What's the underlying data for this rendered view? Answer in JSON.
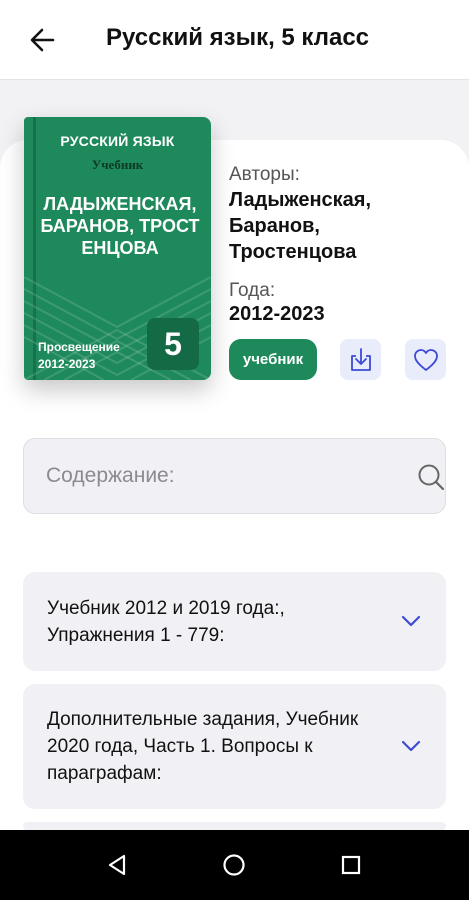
{
  "header": {
    "title": "Русский язык, 5 класс",
    "back_icon": "arrow-left-icon"
  },
  "book_cover": {
    "subject": "РУССКИЙ ЯЗЫК",
    "kind": "Учебник",
    "authors": "ЛАДЫЖЕНСКАЯ, БАРАНОВ, ТРОСТЕНЦОВА",
    "publisher": "Просвещение",
    "years": "2012-2023",
    "grade": "5",
    "color": "#1e8a5b"
  },
  "details": {
    "authors_label": "Авторы:",
    "authors_value": "Ладыженская, Баранов, Тростенцова",
    "years_label": "Года:",
    "years_value": "2012-2023",
    "type_button": "учебник",
    "download_icon": "download-icon",
    "favorite_icon": "heart-icon"
  },
  "search": {
    "placeholder": "Содержание:",
    "icon": "search-icon"
  },
  "sections": [
    {
      "title": "Учебник 2012 и 2019 года:, Упражнения 1 - 779:",
      "icon": "chevron-down-icon"
    },
    {
      "title": "Дополнительные задания, Учебник 2020 года, Часть 1. Вопросы к параграфам:",
      "icon": "chevron-down-icon"
    }
  ],
  "nav": {
    "back": "nav-back-icon",
    "home": "nav-home-icon",
    "recents": "nav-recents-icon"
  },
  "colors": {
    "accent_green": "#1e8a5b",
    "chevron_blue": "#3d4ad6",
    "icon_button_bg": "#e9ecfb"
  }
}
